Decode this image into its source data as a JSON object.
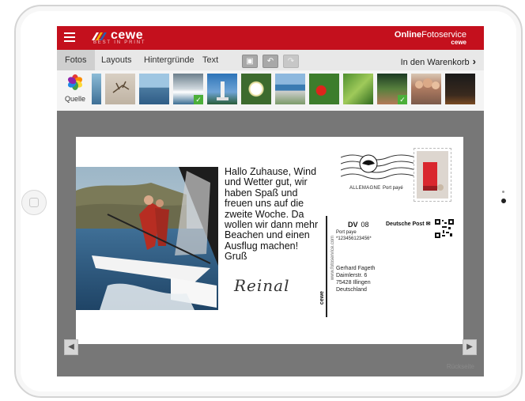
{
  "header": {
    "brand": "cewe",
    "brand_sub": "BEST IN PRINT",
    "online_bold": "Online",
    "online_rest": "Fotoservice",
    "online_small": "cewe"
  },
  "tabs": [
    {
      "label": "Fotos",
      "active": true
    },
    {
      "label": "Layouts"
    },
    {
      "label": "Hintergründe"
    },
    {
      "label": "Text"
    }
  ],
  "tools": [
    {
      "icon": "crop-icon",
      "glyph": "▣"
    },
    {
      "icon": "undo-icon",
      "glyph": "↶"
    },
    {
      "icon": "redo-icon",
      "glyph": "↷"
    }
  ],
  "cart_label": "In den Warenkorb",
  "source_label": "Quelle",
  "thumbnails": [
    {
      "name": "sailing-photo",
      "used": false
    },
    {
      "name": "insect-photo",
      "used": false
    },
    {
      "name": "harbor-photo",
      "used": false
    },
    {
      "name": "catamaran-photo",
      "used": true
    },
    {
      "name": "statue-photo",
      "used": false
    },
    {
      "name": "white-flower-photo",
      "used": false
    },
    {
      "name": "coast-photo",
      "used": false
    },
    {
      "name": "red-flower-photo",
      "used": false
    },
    {
      "name": "green-plant-photo",
      "used": false
    },
    {
      "name": "garden-photo",
      "used": true
    },
    {
      "name": "family-photo",
      "used": false
    },
    {
      "name": "night-photo",
      "used": false
    }
  ],
  "card": {
    "message": "Hallo Zuhause, Wind und Wetter gut, wir haben Spaß und freuen uns auf die zweite Woche. Da wollen wir dann mehr Beachen und einen Ausflug machen! Gruß",
    "signature": "Reinal",
    "stamp_country": "ALLEMAGNE",
    "stamp_paid": "Port payé",
    "dv_label": "DV",
    "dv_number": "08",
    "port_paye": "Port paye",
    "code": "*123456123456*",
    "postal_brand": "Deutsche Post",
    "side_print": "www.fotoservice.com",
    "side_brand": "cewe",
    "address": [
      "Gerhard Fageth",
      "Daimlerstr. 6",
      "75428 Illingen",
      "Deutschland"
    ]
  },
  "footer": {
    "back_label": "Rückseite"
  },
  "colors": {
    "brand_red": "#c4101d",
    "check_green": "#4caf3a"
  }
}
